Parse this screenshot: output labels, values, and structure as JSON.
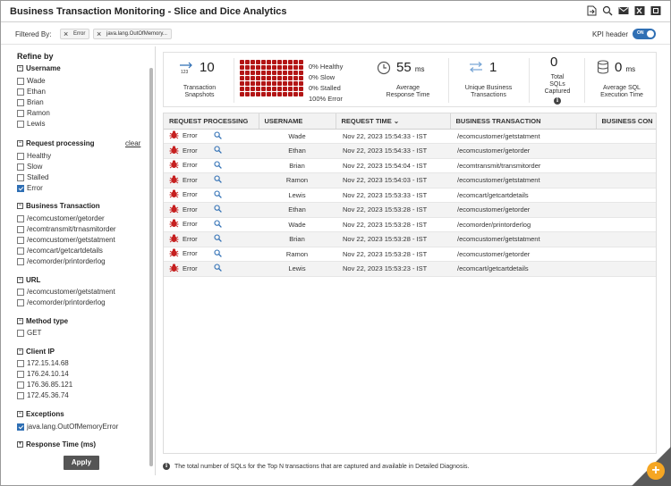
{
  "window": {
    "title": "Business Transaction Monitoring - Slice and Dice Analytics"
  },
  "title_icons": [
    "export-icon",
    "search-settings-icon",
    "email-icon",
    "excel-icon",
    "pdf-icon"
  ],
  "filterbar": {
    "label": "Filtered By:",
    "chips": [
      "Error",
      "java.lang.OutOfMemory..."
    ],
    "kpi_label": "KPI header",
    "toggle_text": "ON"
  },
  "sidebar": {
    "title": "Refine by",
    "clear": "clear",
    "apply": "Apply",
    "sections": {
      "username": {
        "title": "Username",
        "options": [
          "Wade",
          "Ethan",
          "Brian",
          "Ramon",
          "Lewis"
        ]
      },
      "request": {
        "title": "Request processing",
        "options": [
          "Healthy",
          "Slow",
          "Stalled",
          "Error"
        ]
      },
      "bt": {
        "title": "Business Transaction",
        "options": [
          "/ecomcustomer/getorder",
          "/ecomtransmit/trnasmitorder",
          "/ecomcustomer/getstatment",
          "/ecomcart/getcartdetails",
          "/ecomorder/printorderlog"
        ]
      },
      "url": {
        "title": "URL",
        "options": [
          "/ecomcustomer/getstatment",
          "/ecomorder/printorderlog"
        ]
      },
      "method": {
        "title": "Method type",
        "options": [
          "GET"
        ]
      },
      "clientip": {
        "title": "Client IP",
        "options": [
          "172.15.14.68",
          "176.24.10.14",
          "176.36.85.121",
          "172.45.36.74"
        ]
      },
      "exceptions": {
        "title": "Exceptions",
        "options": [
          "java.lang.OutOfMemoryError"
        ]
      },
      "response": {
        "title": "Response Time (ms)"
      }
    }
  },
  "kpis": {
    "snapshots": {
      "value": "10",
      "caption1": "Transaction",
      "caption2": "Snapshots",
      "icon": "snapshot-icon"
    },
    "health": {
      "rows": [
        "0%  Healthy",
        "0%  Slow",
        "0%  Stalled",
        "100%  Error"
      ],
      "color": "#b31515"
    },
    "response": {
      "value": "55",
      "unit": "ms",
      "caption1": "Average",
      "caption2": "Response Time",
      "icon": "clock-icon"
    },
    "unique": {
      "value": "1",
      "caption1": "Unique Business",
      "caption2": "Transactions",
      "icon": "transfer-icon"
    },
    "sqls": {
      "value": "0",
      "caption1": "Total",
      "caption2": "SQLs",
      "caption3": "Captured"
    },
    "sqltime": {
      "value": "0",
      "unit": "ms",
      "caption1": "Average SQL",
      "caption2": "Execution Time",
      "icon": "database-icon"
    }
  },
  "table": {
    "headers": [
      "REQUEST PROCESSING",
      "USERNAME",
      "REQUEST TIME",
      "BUSINESS TRANSACTION",
      "BUSINESS CON"
    ],
    "rows": [
      {
        "status": "Error",
        "user": "Wade",
        "time": "Nov 22, 2023 15:54:33 - IST",
        "bt": "/ecomcustomer/getstatment",
        "con": "-"
      },
      {
        "status": "Error",
        "user": "Ethan",
        "time": "Nov 22, 2023 15:54:33 - IST",
        "bt": "/ecomcustomer/getorder",
        "con": "-"
      },
      {
        "status": "Error",
        "user": "Brian",
        "time": "Nov 22, 2023 15:54:04 - IST",
        "bt": "/ecomtransmit/transmitorder",
        "con": "-"
      },
      {
        "status": "Error",
        "user": "Ramon",
        "time": "Nov 22, 2023 15:54:03 - IST",
        "bt": "/ecomcustomer/getstatment",
        "con": "-"
      },
      {
        "status": "Error",
        "user": "Lewis",
        "time": "Nov 22, 2023 15:53:33 - IST",
        "bt": "/ecomcart/getcartdetails",
        "con": "-"
      },
      {
        "status": "Error",
        "user": "Ethan",
        "time": "Nov 22, 2023 15:53:28 - IST",
        "bt": "/ecomcustomer/getorder",
        "con": "-"
      },
      {
        "status": "Error",
        "user": "Wade",
        "time": "Nov 22, 2023 15:53:28 - IST",
        "bt": "/ecomorder/printorderlog",
        "con": "-"
      },
      {
        "status": "Error",
        "user": "Brian",
        "time": "Nov 22, 2023 15:53:28 - IST",
        "bt": "/ecomcustomer/getstatment",
        "con": "-"
      },
      {
        "status": "Error",
        "user": "Ramon",
        "time": "Nov 22, 2023 15:53:28 - IST",
        "bt": "/ecomcustomer/getorder",
        "con": "-"
      },
      {
        "status": "Error",
        "user": "Lewis",
        "time": "Nov 22, 2023 15:53:23 - IST",
        "bt": "/ecomcart/getcartdetails",
        "con": "-"
      }
    ]
  },
  "footnote": "The total number of SQLs for the Top N transactions that are captured and available in Detailed Diagnosis."
}
